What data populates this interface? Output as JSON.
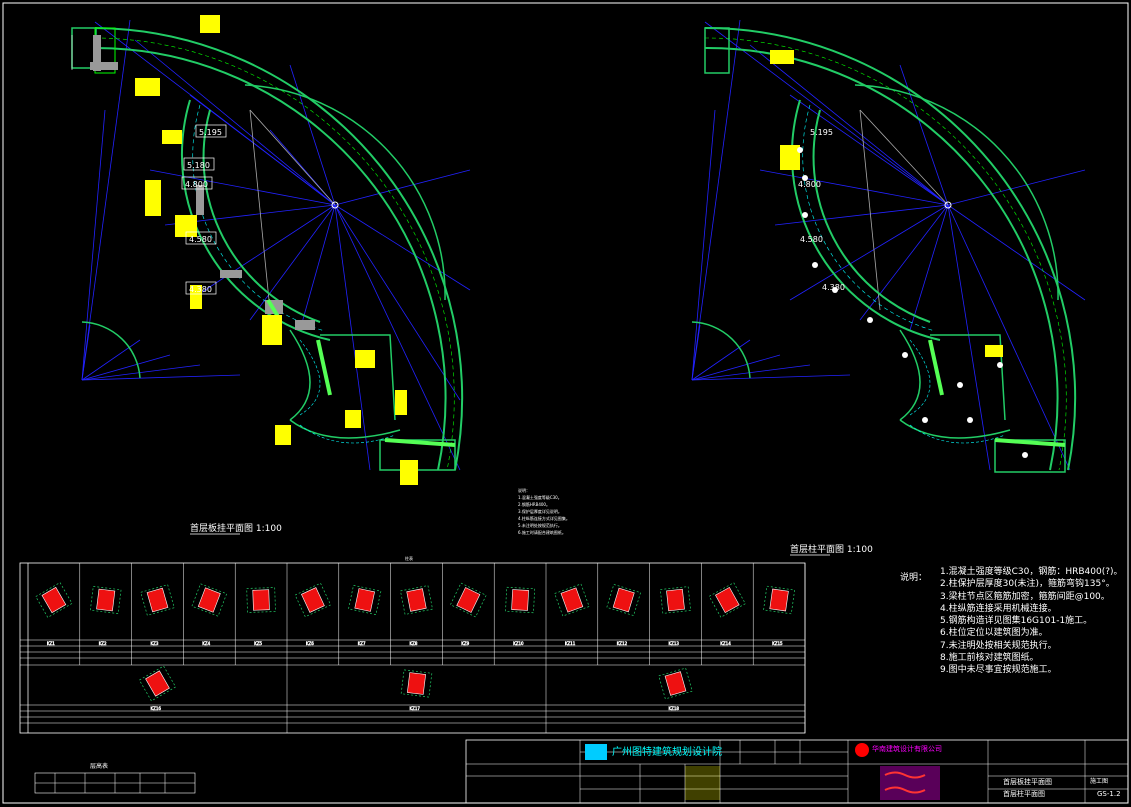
{
  "drawing": {
    "left_plan_title": "首层板挂平面图 1:100",
    "right_plan_title": "首层柱平面图 1:100",
    "left_dims": [
      "5.195",
      "5.180",
      "4.800",
      "4.580",
      "4.380"
    ],
    "right_dims": [
      "5.195",
      "4.800",
      "4.580",
      "4.380"
    ],
    "notes_heading": "说明：",
    "notes": [
      "1.混凝土强度等级C30，钢筋：HRB400(?)。",
      "2.柱保护层厚度30(未注)，箍筋弯钩135°。",
      "3.梁柱节点区箍筋加密，箍筋间距@100。",
      "4.柱纵筋连接采用机械连接。",
      "5.钢筋构造详见图集16G101-1施工。",
      "6.柱位定位以建筑图为准。",
      "7.未注明处按相关规范执行。",
      "8.施工前核对建筑图纸。",
      "9.图中未尽事宜按规范施工。"
    ],
    "small_notes": [
      "说明：",
      "1.混凝土强度等级C30。",
      "2.钢筋HRB400。",
      "3.保护层厚度详见说明。",
      "4.柱纵筋连接方式详见图集。",
      "5.未注明处按规范执行。",
      "6.施工时请配合建筑图纸。"
    ],
    "column_schedule_title": "柱表",
    "columns_row1": [
      "KZ1",
      "KZ2",
      "KZ3",
      "KZ4",
      "KZ5",
      "KZ6",
      "KZ7",
      "KZ8",
      "KZ9",
      "KZ10",
      "KZ11",
      "KZ12",
      "KZ13",
      "KZ14",
      "KZ15"
    ],
    "columns_row2": [
      "KZ16",
      "KZ17",
      "KZ18"
    ],
    "small_table_title": "层高表",
    "title_block": {
      "company": "广州图特建筑规划设计院",
      "partner": "华南建筑设计有限公司",
      "drawing_name_1": "首层板挂平面图",
      "drawing_name_2": "首层柱平面图",
      "drawing_no": "GS-1.2",
      "stage": "施工图",
      "scale": "1:100"
    }
  }
}
